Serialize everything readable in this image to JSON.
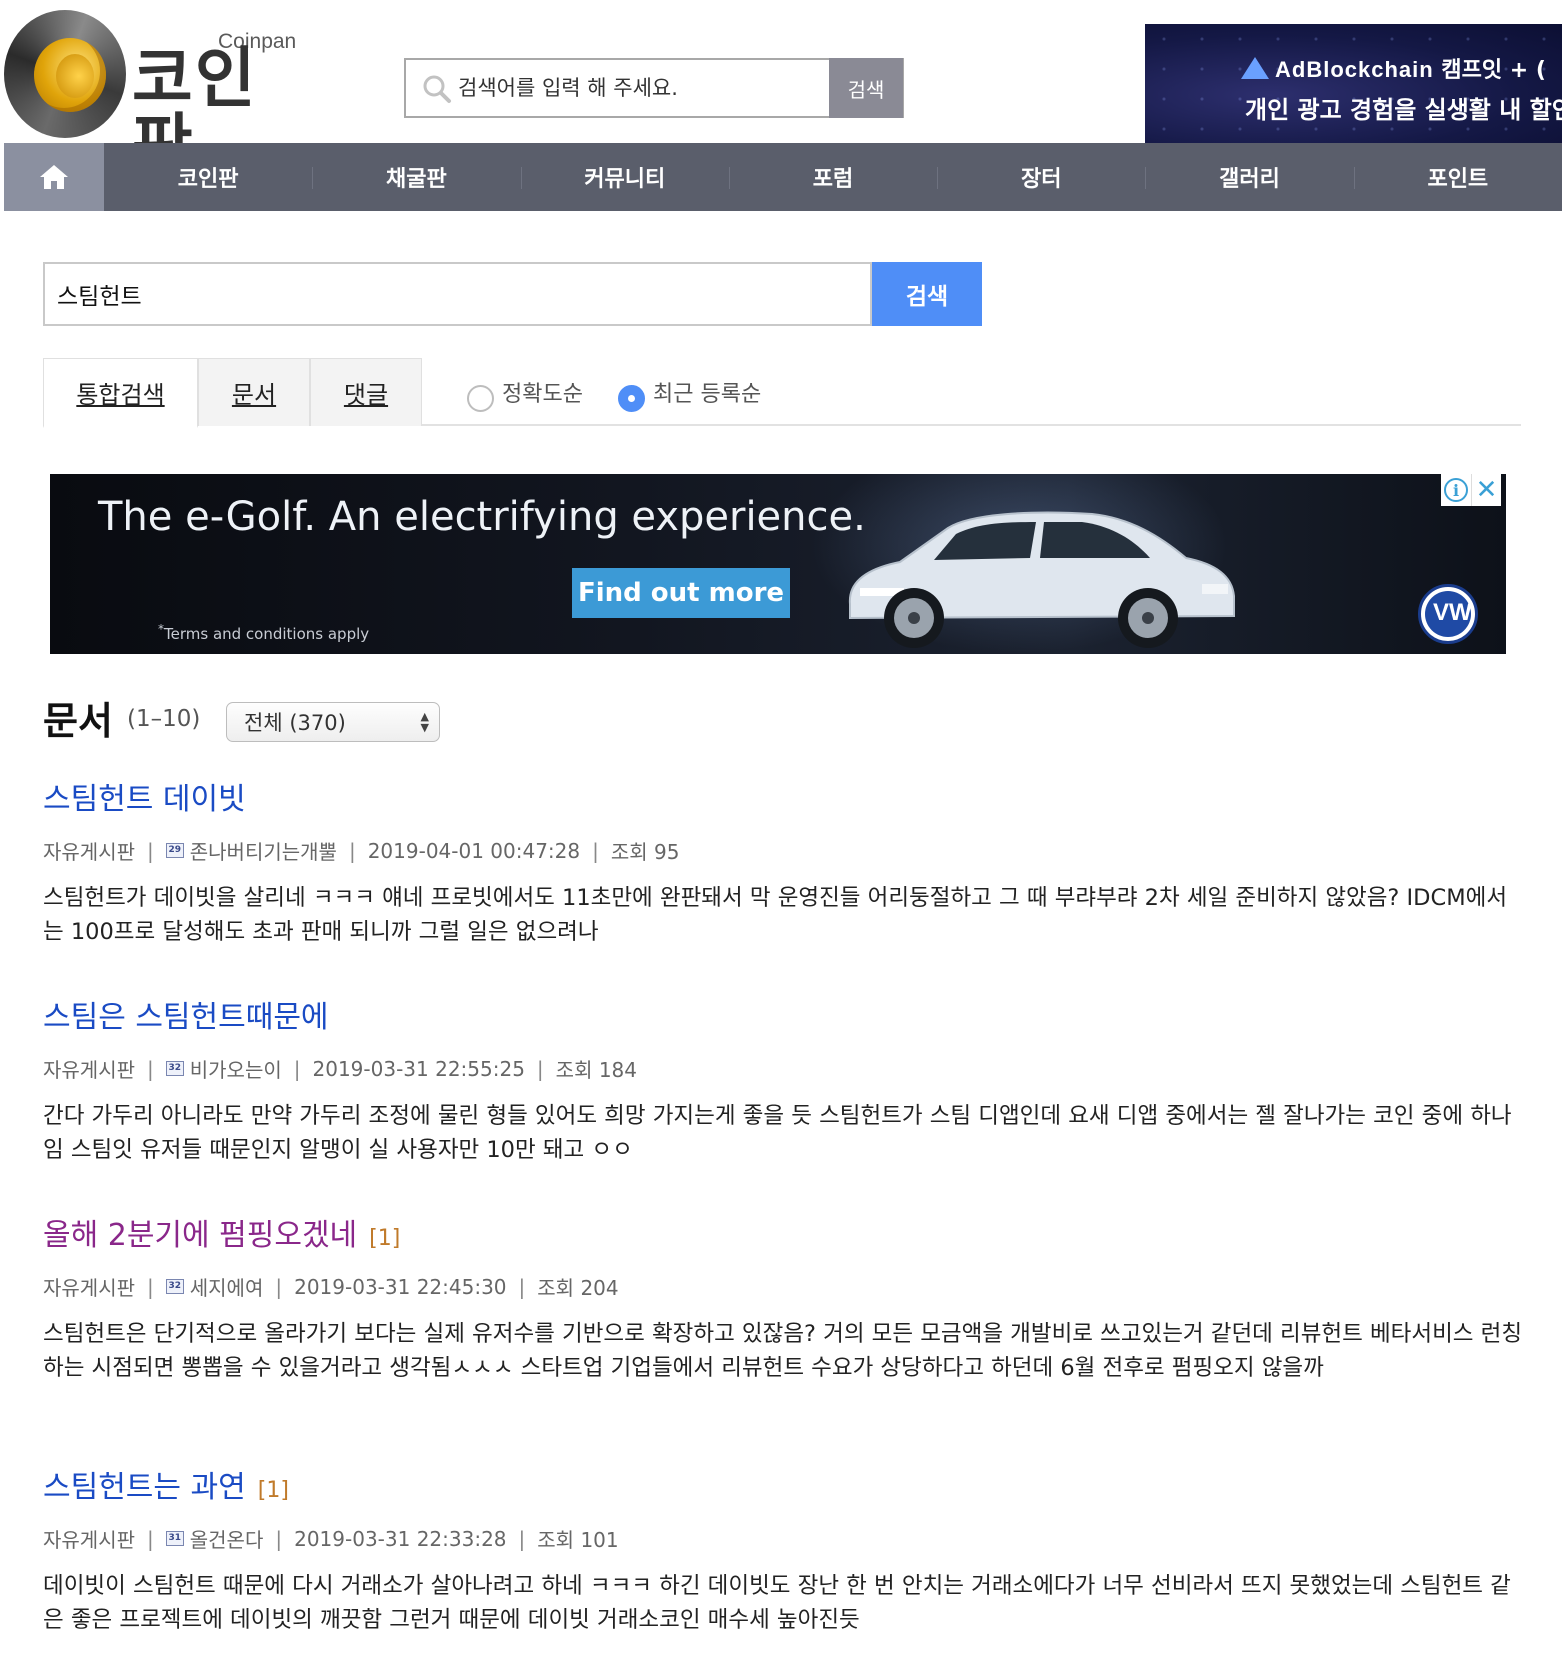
{
  "header": {
    "logo_en": "Coinpan",
    "logo_ko": "코인판",
    "search_placeholder": "검색어를 입력 해 주세요.",
    "search_button": "검색",
    "ad_brand": "AdBlockchain",
    "ad_line1_suffix": "캠프잇 + (",
    "ad_line2": "개인 광고 경험을 실생활 내 할인"
  },
  "nav": {
    "items": [
      "코인판",
      "채굴판",
      "커뮤니티",
      "포럼",
      "장터",
      "갤러리",
      "포인트"
    ]
  },
  "search": {
    "query": "스팀헌트",
    "button": "검색"
  },
  "tabs": {
    "items": [
      "통합검색",
      "문서",
      "댓글"
    ],
    "active": "통합검색"
  },
  "sort": {
    "options": [
      "정확도순",
      "최근 등록순"
    ],
    "selected": "최근 등록순"
  },
  "banner": {
    "headline": "The e-Golf. An electrifying experience.",
    "cta": "Find out more",
    "terms_mark": "*",
    "terms": "Terms and conditions apply",
    "logo": "VW"
  },
  "documents": {
    "title": "문서",
    "range": "(1–10)",
    "filter": "전체 (370)",
    "posts": [
      {
        "title": "스팀헌트 데이빗",
        "comments": "",
        "visited": false,
        "board": "자유게시판",
        "level": "29",
        "author": "존나버티기는개뿔",
        "date": "2019-04-01 00:47:28",
        "views": "조회 95",
        "body": "스팀헌트가 데이빗을 살리네 ㅋㅋㅋ 얘네 프로빗에서도 11초만에 완판돼서 막 운영진들 어리둥절하고 그 때 부랴부랴 2차 세일 준비하지 않았음? IDCM에서는 100프로 달성해도 초과 판매 되니까 그럴 일은 없으려나"
      },
      {
        "title": "스팀은 스팀헌트때문에",
        "comments": "",
        "visited": false,
        "board": "자유게시판",
        "level": "32",
        "author": "비가오는이",
        "date": "2019-03-31 22:55:25",
        "views": "조회 184",
        "body": "간다 가두리 아니라도 만약 가두리 조정에 물린 형들 있어도 희망 가지는게 좋을 듯 스팀헌트가 스팀 디앱인데 요새 디앱 중에서는 젤 잘나가는 코인 중에 하나임 스팀잇 유저들 때문인지 알맹이 실 사용자만 10만 돼고 ㅇㅇ"
      },
      {
        "title": "올해 2분기에 펌핑오겠네",
        "comments": "[1]",
        "visited": true,
        "board": "자유게시판",
        "level": "32",
        "author": "세지에여",
        "date": "2019-03-31 22:45:30",
        "views": "조회 204",
        "body": "스팀헌트은 단기적으로 올라가기 보다는 실제 유저수를 기반으로 확장하고 있잖음? 거의 모든 모금액을 개발비로 쓰고있는거 같던데 리뷰헌트 베타서비스 런칭하는 시점되면 뽕뽑을 수 있을거라고 생각됨ㅅㅅㅅ 스타트업 기업들에서 리뷰헌트 수요가 상당하다고 하던데 6월 전후로 펌핑오지 않을까"
      },
      {
        "title": "스팀헌트는 과연",
        "comments": "[1]",
        "visited": false,
        "board": "자유게시판",
        "level": "31",
        "author": "올건온다",
        "date": "2019-03-31 22:33:28",
        "views": "조회 101",
        "body": "데이빗이 스팀헌트 때문에 다시 거래소가 살아나려고 하네 ㅋㅋㅋ 하긴 데이빗도 장난 한 번 안치는 거래소에다가 너무 선비라서 뜨지 못했었는데 스팀헌트 같은 좋은 프로젝트에 데이빗의 깨끗함 그런거 때문에 데이빗 거래소코인 매수세 높아진듯"
      }
    ]
  }
}
